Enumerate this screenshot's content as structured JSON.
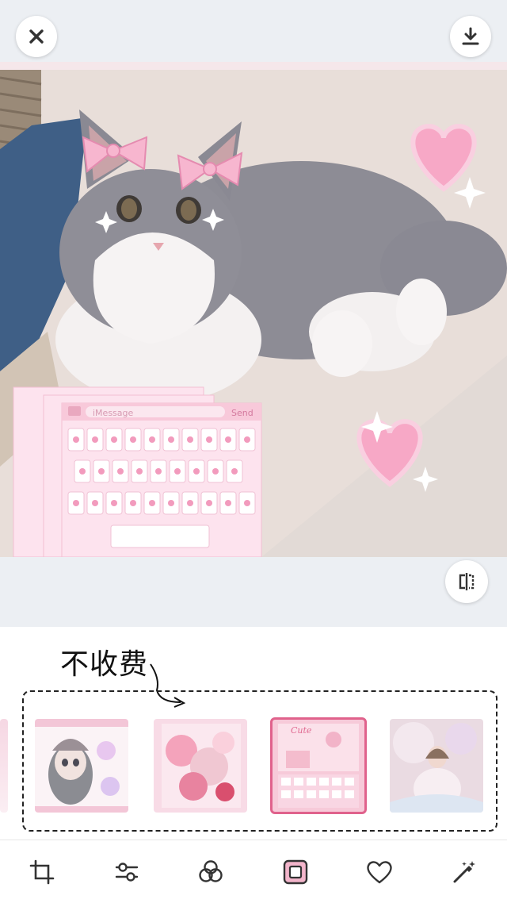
{
  "header": {
    "close_icon": "close-icon",
    "download_icon": "download-icon"
  },
  "editor": {
    "compare_icon": "compare-split-icon",
    "keyboard_mockup": {
      "field_placeholder": "iMessage",
      "send_label": "Send"
    }
  },
  "annotation": {
    "note_text": "不收费"
  },
  "filters": {
    "thumbnails": [
      {
        "name": "doll-theme",
        "selected": false
      },
      {
        "name": "pink-roses-theme",
        "selected": false
      },
      {
        "name": "cute-keyboard-theme",
        "selected": true
      },
      {
        "name": "princess-doll-theme",
        "selected": false
      }
    ]
  },
  "toolbar": {
    "tools": [
      "crop-icon",
      "adjust-icon",
      "filters-icon",
      "frame-icon",
      "heart-sticker-icon",
      "magic-wand-icon"
    ],
    "active_tool": "frame-icon",
    "accent_color": "#e0628c"
  },
  "thumb_mini": {
    "label": "Cute"
  }
}
